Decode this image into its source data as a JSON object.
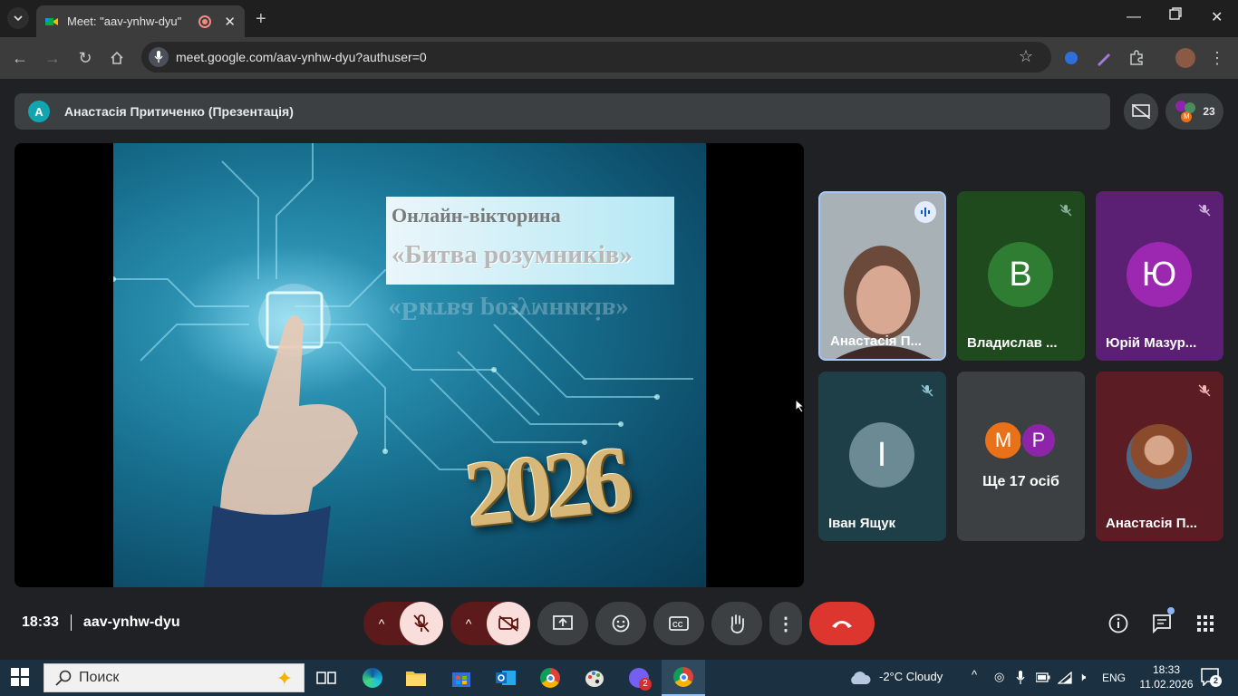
{
  "browser": {
    "tab_title": "Meet: \"aav-ynhw-dyu\"",
    "url": "meet.google.com/aav-ynhw-dyu?authuser=0"
  },
  "meet": {
    "presenter_initial": "A",
    "presenter_label": "Анастасія Притиченко (Презентація)",
    "participant_count": "23",
    "participants_icon_initial": "M",
    "slide": {
      "line1": "Онлайн-вікторина",
      "line2": "«Битва розумників»",
      "reflection": "«Битва розумників»",
      "year": "2026"
    },
    "tiles": [
      {
        "name": "Анастасія П...",
        "status": "speaking"
      },
      {
        "name": "Владислав ...",
        "initial": "В",
        "color": "#2e7d32",
        "bg": "#1b4d1f"
      },
      {
        "name": "Юрій Мазур...",
        "initial": "Ю",
        "color": "#8e24aa",
        "bg": "#4a1563"
      },
      {
        "name": "Іван Ящук",
        "initial": "І",
        "color": "#5f7d88",
        "bg": "#1f3b44"
      },
      {
        "others_label": "Ще 17 осіб",
        "av1": "M",
        "av1_color": "#e8711a",
        "av2": "P",
        "av2_color": "#8e24aa"
      },
      {
        "name": "Анастасія П...",
        "bg": "#5c1a22"
      }
    ],
    "time": "18:33",
    "meeting_code": "aav-ynhw-dyu"
  },
  "taskbar": {
    "search_placeholder": "Поиск",
    "weather": "-2°C  Cloudy",
    "lang": "ENG",
    "time": "18:33",
    "date": "11.02.2026",
    "badge": "2"
  }
}
